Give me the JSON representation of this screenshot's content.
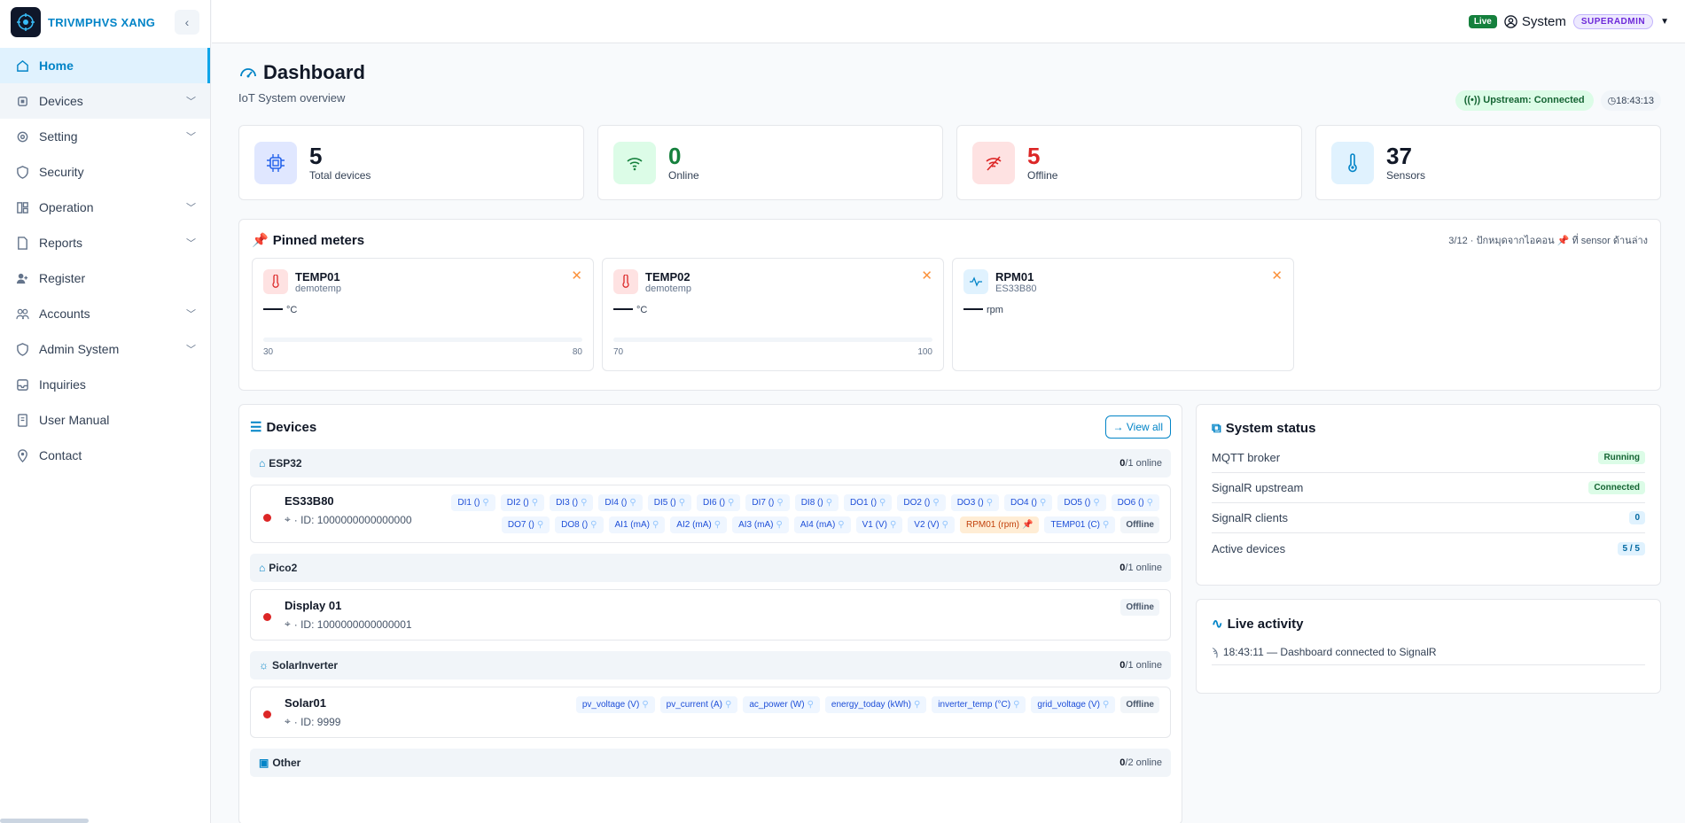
{
  "brand": {
    "name": "TRIVMPHVS XANG"
  },
  "sidebar": {
    "items": [
      {
        "label": "Home"
      },
      {
        "label": "Devices"
      },
      {
        "label": "Setting"
      },
      {
        "label": "Security"
      },
      {
        "label": "Operation"
      },
      {
        "label": "Reports"
      },
      {
        "label": "Register"
      },
      {
        "label": "Accounts"
      },
      {
        "label": "Admin System"
      },
      {
        "label": "Inquiries"
      },
      {
        "label": "User Manual"
      },
      {
        "label": "Contact"
      }
    ]
  },
  "topbar": {
    "live": "Live",
    "user": "System",
    "role": "SUPERADMIN"
  },
  "page": {
    "title": "Dashboard",
    "subtitle": "IoT System overview",
    "upstream": "Upstream: Connected",
    "time": "18:43:13"
  },
  "stats": [
    {
      "value": "5",
      "label": "Total devices",
      "color": "#111827"
    },
    {
      "value": "0",
      "label": "Online",
      "color": "#15803d"
    },
    {
      "value": "5",
      "label": "Offline",
      "color": "#dc2626"
    },
    {
      "value": "37",
      "label": "Sensors",
      "color": "#111827"
    }
  ],
  "pinned": {
    "title": "Pinned meters",
    "hint": "3/12 · ปักหมุดจากไอคอน 📌 ที่ sensor ด้านล่าง",
    "meters": [
      {
        "name": "TEMP01",
        "sub": "demotemp",
        "unit": "°C",
        "min": "30",
        "max": "80"
      },
      {
        "name": "TEMP02",
        "sub": "demotemp",
        "unit": "°C",
        "min": "70",
        "max": "100"
      },
      {
        "name": "RPM01",
        "sub": "ES33B80",
        "unit": "rpm"
      }
    ]
  },
  "devices": {
    "title": "Devices",
    "view_all": "→ View all",
    "groups": [
      {
        "name": "ESP32",
        "online": "0",
        "total": "/1 online"
      },
      {
        "name": "Pico2",
        "online": "0",
        "total": "/1 online"
      },
      {
        "name": "SolarInverter",
        "online": "0",
        "total": "/1 online"
      },
      {
        "name": "Other",
        "online": "0",
        "total": "/2 online"
      }
    ],
    "es33": {
      "name": "ES33B80",
      "id": "· ID: 1000000000000000",
      "tags": [
        "DI1 ()",
        "DI2 ()",
        "DI3 ()",
        "DI4 ()",
        "DI5 ()",
        "DI6 ()",
        "DI7 ()",
        "DI8 ()",
        "DO1 ()",
        "DO2 ()",
        "DO3 ()",
        "DO4 ()",
        "DO5 ()",
        "DO6 ()",
        "DO7 ()",
        "DO8 ()",
        "AI1 (mA)",
        "AI2 (mA)",
        "AI3 (mA)",
        "AI4 (mA)",
        "V1 (V)",
        "V2 (V)"
      ],
      "pinned_tag": "RPM01 (rpm)",
      "last_tag": "TEMP01 (C)",
      "status": "Offline"
    },
    "display": {
      "name": "Display 01",
      "id": "· ID: 1000000000000001",
      "status": "Offline"
    },
    "solar": {
      "name": "Solar01",
      "id": "· ID: 9999",
      "tags": [
        "pv_voltage (V)",
        "pv_current (A)",
        "ac_power (W)",
        "energy_today (kWh)",
        "inverter_temp (°C)",
        "grid_voltage (V)"
      ],
      "status": "Offline"
    }
  },
  "system": {
    "title": "System status",
    "rows": [
      {
        "label": "MQTT broker",
        "value": "Running"
      },
      {
        "label": "SignalR upstream",
        "value": "Connected"
      },
      {
        "label": "SignalR clients",
        "value": "0"
      },
      {
        "label": "Active devices",
        "value": "5 / 5"
      }
    ]
  },
  "activity": {
    "title": "Live activity",
    "entry": "18:43:11 — Dashboard connected to SignalR"
  },
  "colors": {
    "accent": "#0284c7",
    "offline": "#dc2626",
    "online": "#15803d"
  }
}
